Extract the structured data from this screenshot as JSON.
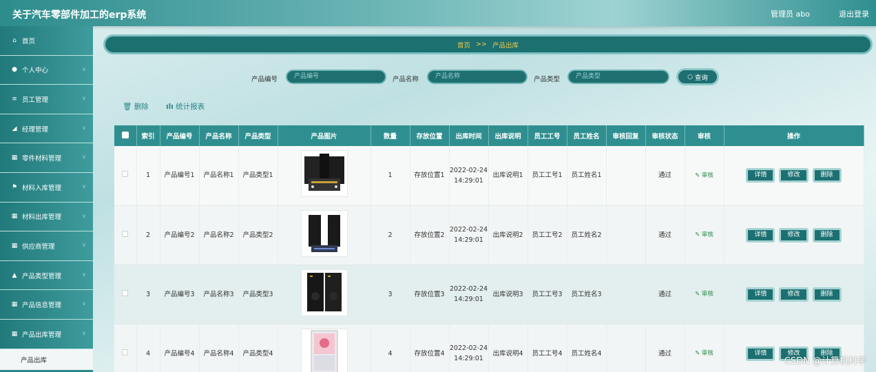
{
  "app": {
    "title": "关于汽车零部件加工的erp系统",
    "user": "管理员 abo",
    "logout": "退出登录"
  },
  "sidebar": {
    "items": [
      {
        "label": "首页",
        "icon": "home-icon",
        "glyph": "⌂",
        "chev": false
      },
      {
        "label": "个人中心",
        "icon": "user-icon",
        "glyph": "●",
        "chev": true
      },
      {
        "label": "员工管理",
        "icon": "list-icon",
        "glyph": "≡",
        "chev": true
      },
      {
        "label": "经理管理",
        "icon": "manager-icon",
        "glyph": "◢",
        "chev": true
      },
      {
        "label": "零件材料管理",
        "icon": "grid-icon",
        "glyph": "▦",
        "chev": true
      },
      {
        "label": "材料入库管理",
        "icon": "flag-icon",
        "glyph": "⚑",
        "chev": true
      },
      {
        "label": "材料出库管理",
        "icon": "grid-icon",
        "glyph": "▦",
        "chev": true
      },
      {
        "label": "供应商管理",
        "icon": "grid-icon",
        "glyph": "▦",
        "chev": true
      },
      {
        "label": "产品类型管理",
        "icon": "bank-icon",
        "glyph": "▲",
        "chev": true
      },
      {
        "label": "产品信息管理",
        "icon": "grid-icon",
        "glyph": "▦",
        "chev": true
      },
      {
        "label": "产品出库管理",
        "icon": "grid-icon",
        "glyph": "▦",
        "chev": true
      }
    ],
    "sub_item": "产品出库"
  },
  "breadcrumb": {
    "home": "首页",
    "sep": ">>",
    "current": "产品出库"
  },
  "search": {
    "code_label": "产品编号",
    "code_placeholder": "产品编号",
    "name_label": "产品名称",
    "name_placeholder": "产品名称",
    "type_label": "产品类型",
    "type_placeholder": "产品类型",
    "button": "查询"
  },
  "actions": {
    "delete": "删除",
    "report": "统计报表"
  },
  "table": {
    "headers": [
      "索引",
      "产品编号",
      "产品名称",
      "产品类型",
      "产品图片",
      "数量",
      "存放位置",
      "出库时间",
      "出库说明",
      "员工工号",
      "员工姓名",
      "审核回复",
      "审核状态",
      "审核",
      "操作"
    ],
    "rows": [
      {
        "idx": "1",
        "code": "产品编号1",
        "name": "产品名称1",
        "type": "产品类型1",
        "qty": "1",
        "loc": "存放位置1",
        "time": "2022-02-24 14:29:01",
        "desc": "出库说明1",
        "emp_no": "员工工号1",
        "emp_name": "员工姓名1",
        "reply": "",
        "status": "通过",
        "audit": "审核"
      },
      {
        "idx": "2",
        "code": "产品编号2",
        "name": "产品名称2",
        "type": "产品类型2",
        "qty": "2",
        "loc": "存放位置2",
        "time": "2022-02-24 14:29:01",
        "desc": "出库说明2",
        "emp_no": "员工工号2",
        "emp_name": "员工姓名2",
        "reply": "",
        "status": "通过",
        "audit": "审核"
      },
      {
        "idx": "3",
        "code": "产品编号3",
        "name": "产品名称3",
        "type": "产品类型3",
        "qty": "3",
        "loc": "存放位置3",
        "time": "2022-02-24 14:29:01",
        "desc": "出库说明3",
        "emp_no": "员工工号3",
        "emp_name": "员工姓名3",
        "reply": "",
        "status": "通过",
        "audit": "审核"
      },
      {
        "idx": "4",
        "code": "产品编号4",
        "name": "产品名称4",
        "type": "产品类型4",
        "qty": "4",
        "loc": "存放位置4",
        "time": "2022-02-24 14:29:01",
        "desc": "出库说明4",
        "emp_no": "员工工号4",
        "emp_name": "员工姓名4",
        "reply": "",
        "status": "通过",
        "audit": "审核"
      }
    ],
    "ops": {
      "detail": "详情",
      "edit": "修改",
      "delete": "删除"
    }
  },
  "watermark": "CSDN @计算机科学"
}
